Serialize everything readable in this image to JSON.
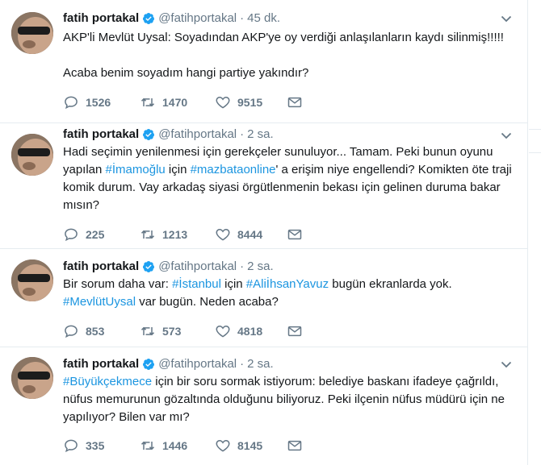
{
  "colors": {
    "link": "#1b95e0",
    "muted": "#657786",
    "text": "#14171a",
    "verified": "#1da1f2"
  },
  "tweets": [
    {
      "name": "fatih portakal",
      "handle": "@fatihportakal",
      "sep": "·",
      "time": "45 dk.",
      "paragraphs": [
        [
          {
            "t": "AKP'li Mevlüt Uysal: Soyadından AKP'ye oy verdiği anlaşılanların kaydı silinmiş!!!!!"
          }
        ],
        [
          {
            "t": "Acaba benim soyadım hangi partiye yakındır?"
          }
        ]
      ],
      "replies": "1526",
      "retweets": "1470",
      "likes": "9515"
    },
    {
      "name": "fatih portakal",
      "handle": "@fatihportakal",
      "sep": "·",
      "time": "2 sa.",
      "paragraphs": [
        [
          {
            "t": "Hadi seçimin yenilenmesi için gerekçeler sunuluyor... Tamam. Peki bunun oyunu yapılan "
          },
          {
            "t": "#İmamoğlu",
            "tag": true
          },
          {
            "t": " için "
          },
          {
            "t": "#mazbataonline",
            "tag": true
          },
          {
            "t": "' a erişim niye engellendi? Komikten öte traji komik durum. Vay arkadaş siyasi örgütlenmenin bekası için gelinen duruma bakar mısın?"
          }
        ]
      ],
      "replies": "225",
      "retweets": "1213",
      "likes": "8444"
    },
    {
      "name": "fatih portakal",
      "handle": "@fatihportakal",
      "sep": "·",
      "time": "2 sa.",
      "paragraphs": [
        [
          {
            "t": "Bir sorum daha var: "
          },
          {
            "t": "#İstanbul",
            "tag": true
          },
          {
            "t": " için "
          },
          {
            "t": "#AliİhsanYavuz",
            "tag": true
          },
          {
            "t": " bugün ekranlarda yok. "
          },
          {
            "t": "#MevlütUysal",
            "tag": true
          },
          {
            "t": " var bugün. Neden acaba?"
          }
        ]
      ],
      "replies": "853",
      "retweets": "573",
      "likes": "4818"
    },
    {
      "name": "fatih portakal",
      "handle": "@fatihportakal",
      "sep": "·",
      "time": "2 sa.",
      "paragraphs": [
        [
          {
            "t": "#Büyükçekmece",
            "tag": true
          },
          {
            "t": " için bir soru sormak istiyorum: belediye baskanı ifadeye çağrıldı, nüfus memurunun gözaltında olduğunu biliyoruz. Peki ilçenin nüfus müdürü için ne yapılıyor? Bilen var mı?"
          }
        ]
      ],
      "replies": "335",
      "retweets": "1446",
      "likes": "8145"
    }
  ]
}
